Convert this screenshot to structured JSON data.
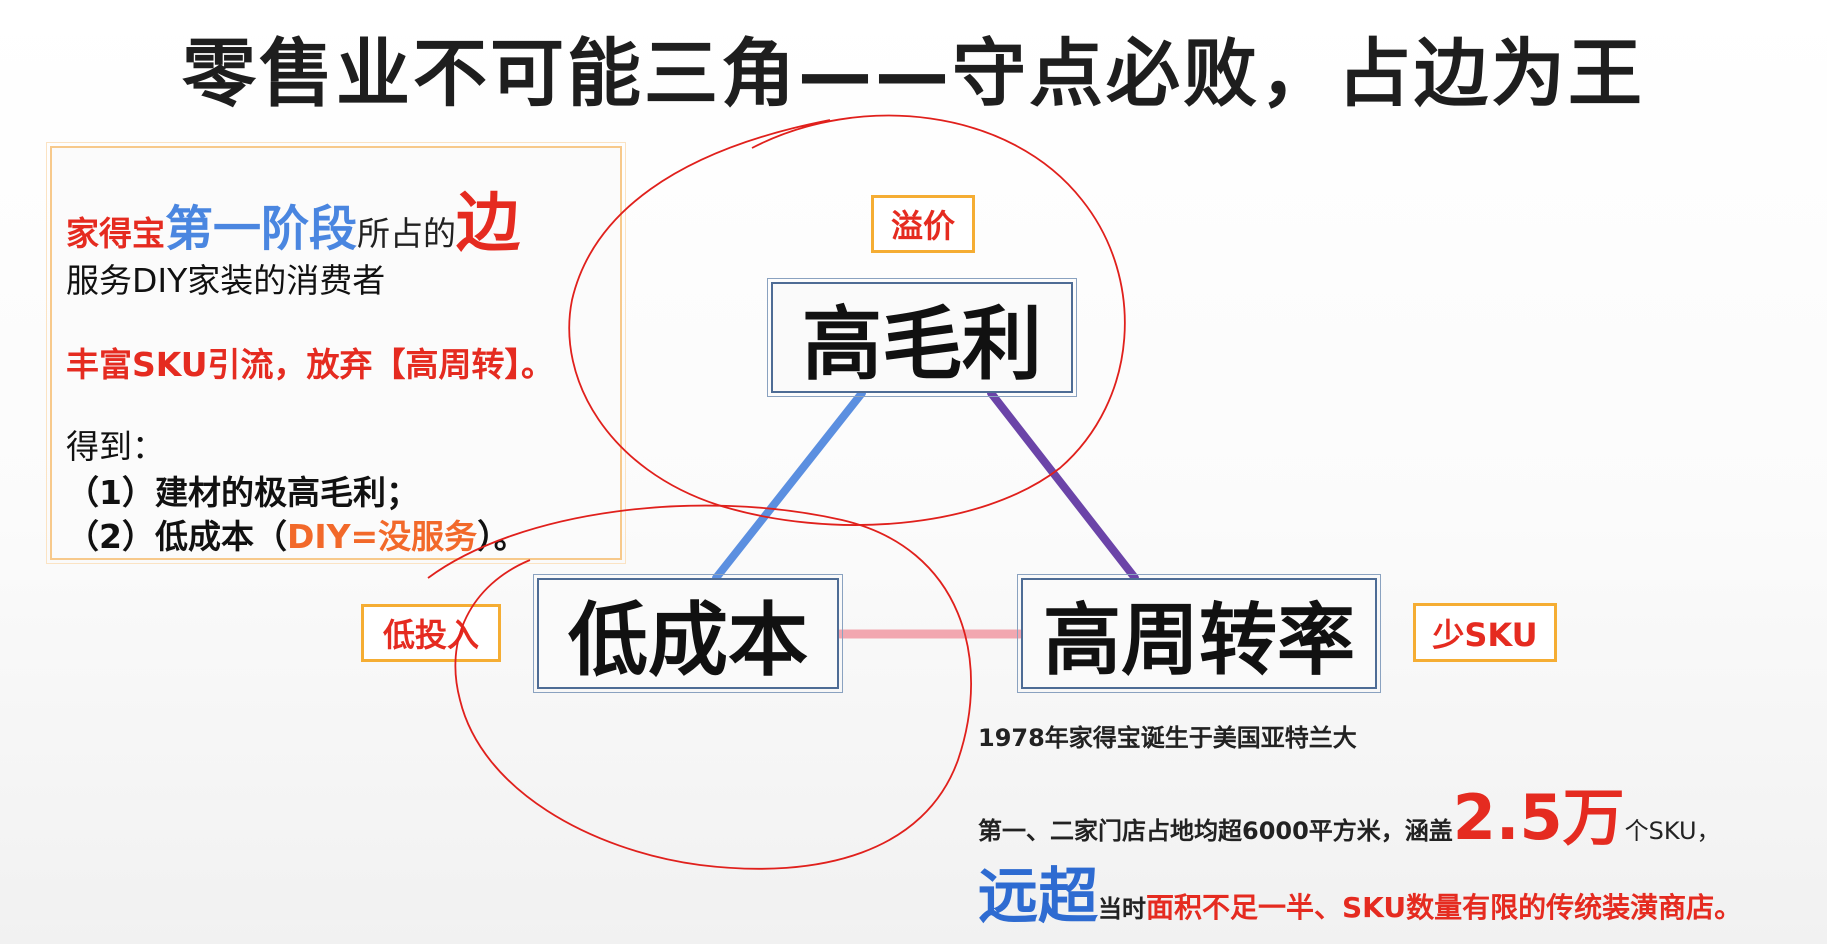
{
  "title": "零售业不可能三角——守点必败，占边为王",
  "panel": {
    "brand": "家得宝",
    "stage": "第一阶段",
    "mid": "所占的",
    "edge": "边",
    "line2": "服务DIY家装的消费者",
    "line3": "丰富SKU引流，放弃【高周转】。",
    "gain_label": "得到：",
    "item1": "（1）建材的极高毛利；",
    "item2_pre": "（2）低成本（",
    "item2_hl": "DIY=没服务",
    "item2_post": "）。"
  },
  "nodes": {
    "top": "高毛利",
    "left": "低成本",
    "right": "高周转率"
  },
  "tags": {
    "top": "溢价",
    "left": "低投入",
    "right": "少SKU"
  },
  "notes": {
    "founding": "1978年家得宝诞生于美国亚特兰大",
    "store_pre": "第一、二家门店占地均超6000平方米，涵盖",
    "store_num": "2.5万",
    "store_post": "个SKU，",
    "far": "远超",
    "then": "当时",
    "compare": "面积不足一半、SKU数量有限的传统装潢商店。"
  },
  "colors": {
    "edge_left": "#5b8fe0",
    "edge_right": "#6b44a8",
    "edge_bottom": "#f2a7b0",
    "annotation": "#e0201c"
  }
}
